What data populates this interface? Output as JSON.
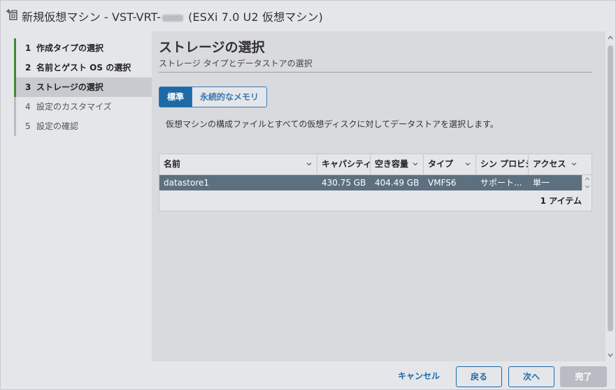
{
  "window": {
    "title_prefix": "新規仮想マシン - VST-VRT-",
    "title_suffix": "(ESXi 7.0 U2 仮想マシン)"
  },
  "steps": [
    {
      "num": "1",
      "label": "作成タイプの選択",
      "state": "done"
    },
    {
      "num": "2",
      "label": "名前とゲスト OS の選択",
      "state": "done"
    },
    {
      "num": "3",
      "label": "ストレージの選択",
      "state": "active"
    },
    {
      "num": "4",
      "label": "設定のカスタマイズ",
      "state": "pending"
    },
    {
      "num": "5",
      "label": "設定の確認",
      "state": "pending"
    }
  ],
  "page": {
    "title": "ストレージの選択",
    "subtitle": "ストレージ タイプとデータストアの選択",
    "tabs": [
      {
        "label": "標準",
        "selected": true
      },
      {
        "label": "永続的なメモリ",
        "selected": false
      }
    ],
    "description": "仮想マシンの構成ファイルとすべての仮想ディスクに対してデータストアを選択します。"
  },
  "grid": {
    "columns": [
      "名前",
      "キャパシティ",
      "空き容量",
      "タイプ",
      "シン プロビジ",
      "アクセス"
    ],
    "rows": [
      {
        "name": "datastore1",
        "capacity": "430.75 GB",
        "free": "404.49 GB",
        "type": "VMFS6",
        "thin": "サポート...",
        "access": "単一"
      }
    ],
    "footer": "1 アイテム"
  },
  "footer": {
    "cancel": "キャンセル",
    "back": "戻る",
    "next": "次へ",
    "finish": "完了"
  },
  "colors": {
    "accent": "#1c6aa6",
    "step_done": "#3b8b2e",
    "selected_row": "#5d707f"
  }
}
